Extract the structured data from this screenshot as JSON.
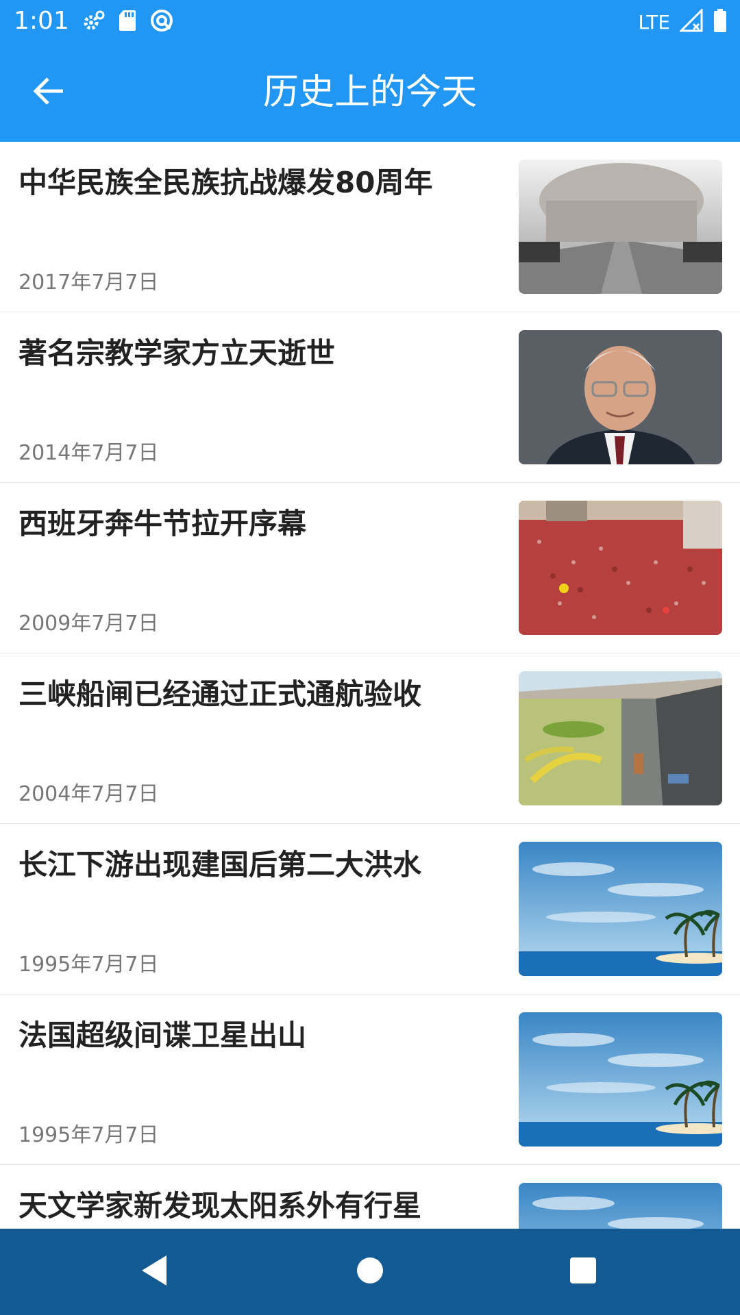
{
  "status_bar": {
    "time": "1:01",
    "network": "LTE",
    "icons_left": [
      "settings-gear-icon",
      "sd-card-icon",
      "sync-circle-icon"
    ],
    "icons_right": [
      "signal-icon",
      "battery-icon"
    ]
  },
  "app_bar": {
    "title": "历史上的今天",
    "back_icon": "arrow-back-icon",
    "color": "#2196F3"
  },
  "events": [
    {
      "title": "中华民族全民族抗战爆发80周年",
      "date": "2017年7月7日",
      "thumb": "memorial-photo"
    },
    {
      "title": "著名宗教学家方立天逝世",
      "date": "2014年7月7日",
      "thumb": "portrait-photo"
    },
    {
      "title": "西班牙奔牛节拉开序幕",
      "date": "2009年7月7日",
      "thumb": "crowd-photo"
    },
    {
      "title": "三峡船闸已经通过正式通航验收",
      "date": "2004年7月7日",
      "thumb": "ship-lock-photo"
    },
    {
      "title": "长江下游出现建国后第二大洪水",
      "date": "1995年7月7日",
      "thumb": "beach-palm-illustration"
    },
    {
      "title": "法国超级间谍卫星出山",
      "date": "1995年7月7日",
      "thumb": "beach-palm-illustration"
    },
    {
      "title": "天文学家新发现太阳系外有行星",
      "date": "",
      "thumb": "beach-palm-illustration"
    }
  ],
  "nav_bar": {
    "color": "#135a92",
    "buttons": [
      "back-triangle-icon",
      "home-circle-icon",
      "recents-square-icon"
    ]
  }
}
